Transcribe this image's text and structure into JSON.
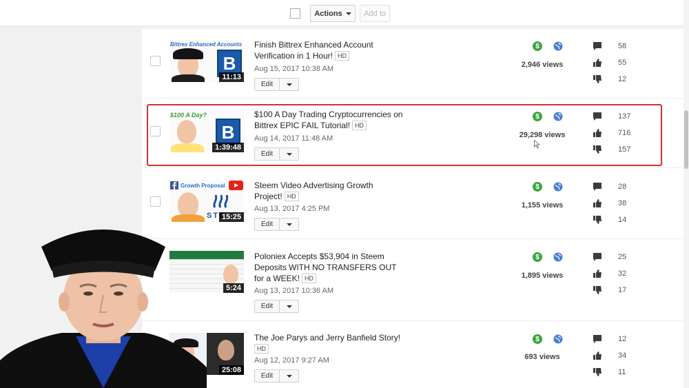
{
  "toolbar": {
    "actions_label": "Actions",
    "add_to_label": "Add to"
  },
  "videos": [
    {
      "thumb_caption": "Bittrex Enhanced Accounts",
      "duration": "11:13",
      "title": "Finish Bittrex Enhanced Account Verification in 1 Hour!",
      "hd": "HD",
      "date": "Aug 15, 2017 10:38 AM",
      "edit_label": "Edit",
      "views": "2,946 views",
      "comments": "58",
      "likes": "55",
      "dislikes": "12"
    },
    {
      "thumb_caption": "$100 A Day?",
      "duration": "1:39:48",
      "title": "$100 A Day Trading Cryptocurrencies on Bittrex EPIC FAIL Tutorial!",
      "hd": "HD",
      "date": "Aug 14, 2017 11:48 AM",
      "edit_label": "Edit",
      "views": "29,298 views",
      "comments": "137",
      "likes": "716",
      "dislikes": "157"
    },
    {
      "thumb_caption": "Growth Proposal",
      "thumb_sub": "STE",
      "duration": "15:25",
      "title": "Steem Video Advertising Growth Project!",
      "hd": "HD",
      "date": "Aug 13, 2017 4:25 PM",
      "edit_label": "Edit",
      "views": "1,155 views",
      "comments": "28",
      "likes": "38",
      "dislikes": "14"
    },
    {
      "duration": "5:24",
      "title": "Poloniex Accepts $53,904 in Steem Deposits WITH NO TRANSFERS OUT for a WEEK!",
      "hd": "HD",
      "date": "Aug 13, 2017 10:36 AM",
      "edit_label": "Edit",
      "views": "1,895 views",
      "comments": "25",
      "likes": "32",
      "dislikes": "17"
    },
    {
      "duration": "25:08",
      "title": "The Joe Parys and Jerry Banfield Story!",
      "hd": "HD",
      "date": "Aug 12, 2017 9:27 AM",
      "edit_label": "Edit",
      "views": "693 views",
      "comments": "12",
      "likes": "34",
      "dislikes": "11"
    }
  ],
  "colors": {
    "highlight": "#d32f2f",
    "monetized": "#3fa63f",
    "public": "#4a7fd4"
  }
}
